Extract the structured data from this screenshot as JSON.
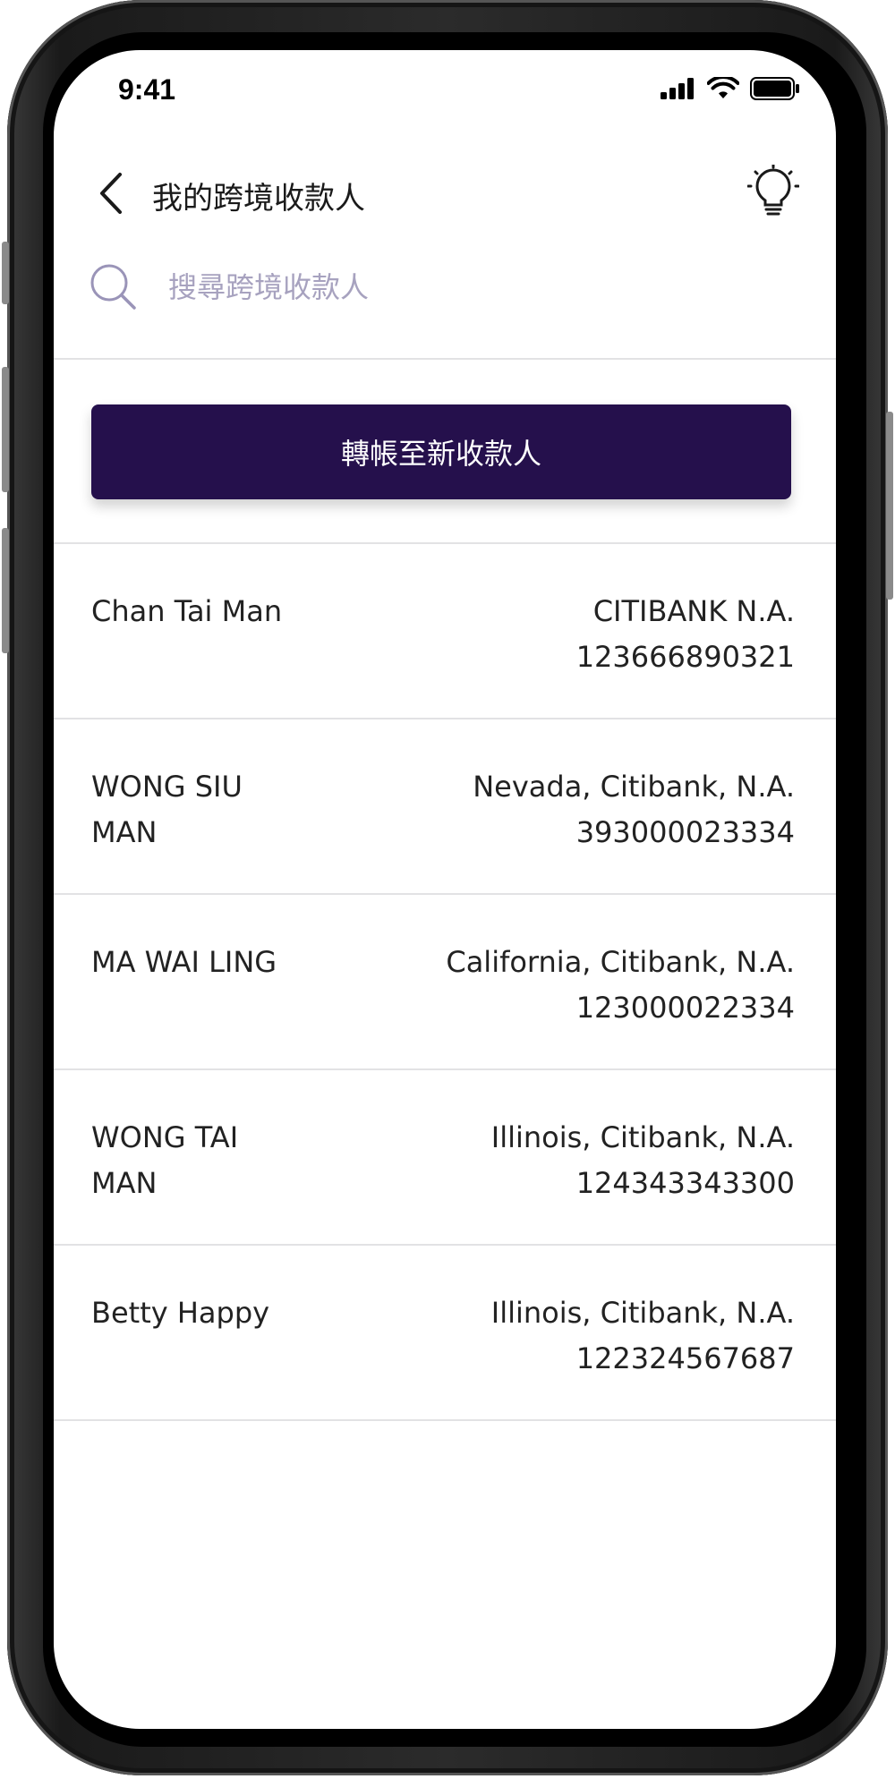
{
  "status_bar": {
    "time": "9:41",
    "icons": [
      "cellular-signal-icon",
      "wifi-icon",
      "battery-icon"
    ]
  },
  "header": {
    "back_icon": "chevron-left-icon",
    "title": "我的跨境收款人",
    "tip_icon": "lightbulb-icon"
  },
  "search": {
    "icon": "search-icon",
    "placeholder": "搜尋跨境收款人",
    "value": ""
  },
  "actions": {
    "new_payee_label": "轉帳至新收款人"
  },
  "payees": [
    {
      "name": "Chan Tai Man",
      "bank": "CITIBANK N.A.",
      "account": "123666890321"
    },
    {
      "name": "WONG SIU MAN",
      "bank": "Nevada, Citibank, N.A.",
      "account": "393000023334"
    },
    {
      "name": "MA WAI LING",
      "bank": "California, Citibank, N.A.",
      "account": "123000022334"
    },
    {
      "name": "WONG TAI MAN",
      "bank": "Illinois, Citibank, N.A.",
      "account": "124343343300"
    },
    {
      "name": "Betty Happy",
      "bank": "Illinois, Citibank, N.A.",
      "account": "122324567687"
    }
  ],
  "colors": {
    "primary": "#25104c",
    "placeholder": "#a7a2bf",
    "search_icon": "#9a94b8",
    "divider": "#e2e2e4",
    "text": "#222222"
  }
}
